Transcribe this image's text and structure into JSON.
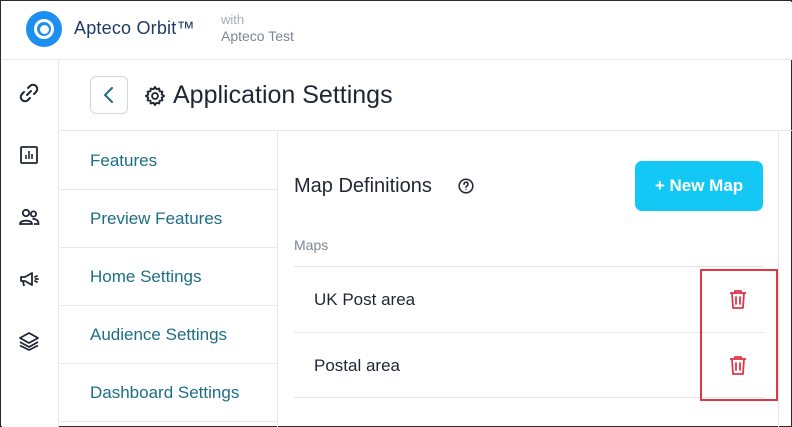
{
  "header": {
    "brand": "Apteco Orbit™",
    "with_label": "with",
    "tenant": "Apteco Test"
  },
  "rail": {
    "icons": [
      "link-icon",
      "chart-icon",
      "people-icon",
      "megaphone-icon",
      "layers-icon"
    ]
  },
  "title_bar": {
    "title": "Application Settings"
  },
  "settings_nav": {
    "items": [
      {
        "label": "Features"
      },
      {
        "label": "Preview Features"
      },
      {
        "label": "Home Settings"
      },
      {
        "label": "Audience Settings"
      },
      {
        "label": "Dashboard Settings"
      }
    ]
  },
  "main": {
    "section_title": "Map Definitions",
    "new_map_label": "+ New Map",
    "maps_label": "Maps",
    "maps": [
      {
        "name": "UK Post area"
      },
      {
        "name": "Postal area"
      }
    ]
  },
  "colors": {
    "accent": "#14c8f5",
    "brand_blue": "#1c8ff0",
    "link_teal": "#1c6e86",
    "delete_red": "#e0354a",
    "highlight_red": "#e0383f"
  }
}
